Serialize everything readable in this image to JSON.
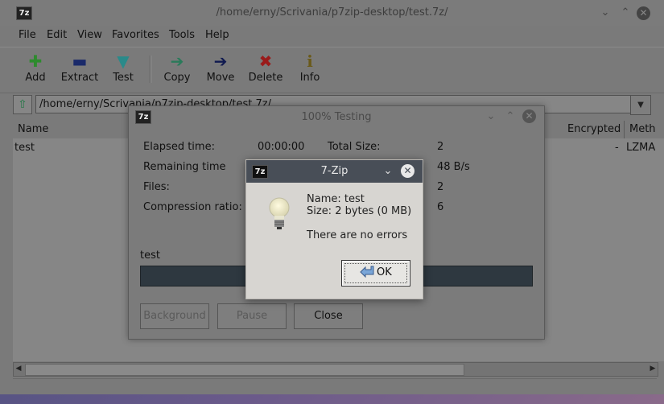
{
  "main_window": {
    "app_icon": "7z",
    "title": "/home/erny/Scrivania/p7zip-desktop/test.7z/",
    "menus": [
      "File",
      "Edit",
      "View",
      "Favorites",
      "Tools",
      "Help"
    ],
    "toolbar": [
      {
        "label": "Add",
        "icon": "add-icon"
      },
      {
        "label": "Extract",
        "icon": "extract-icon"
      },
      {
        "label": "Test",
        "icon": "test-icon"
      },
      {
        "label": "Copy",
        "icon": "copy-icon"
      },
      {
        "label": "Move",
        "icon": "move-icon"
      },
      {
        "label": "Delete",
        "icon": "delete-icon"
      },
      {
        "label": "Info",
        "icon": "info-icon"
      }
    ],
    "address": "/home/erny/Scrivania/p7zip-desktop/test.7z/",
    "columns": {
      "name": "Name",
      "encrypted": "Encrypted",
      "method": "Meth"
    },
    "rows": [
      {
        "name": "test",
        "encrypted": "-",
        "method": "LZMA"
      }
    ]
  },
  "progress_dialog": {
    "app_icon": "7z",
    "title": "100% Testing",
    "elapsed_label": "Elapsed time:",
    "elapsed_value": "00:00:00",
    "remaining_label": "Remaining time",
    "files_label": "Files:",
    "ratio_label": "Compression ratio:",
    "total_size_label": "Total Size:",
    "total_size_value": "2",
    "speed_value": "48 B/s",
    "processed_value": "2",
    "packed_value": "6",
    "current_file": "test",
    "progress": 1.0,
    "buttons": {
      "background": "Background",
      "pause": "Pause",
      "close": "Close"
    }
  },
  "message_box": {
    "app_icon": "7z",
    "title": "7-Zip",
    "name_line": "Name: test",
    "size_line": "Size: 2 bytes (0 MB)",
    "message": "There are no errors",
    "ok_label": "OK"
  }
}
